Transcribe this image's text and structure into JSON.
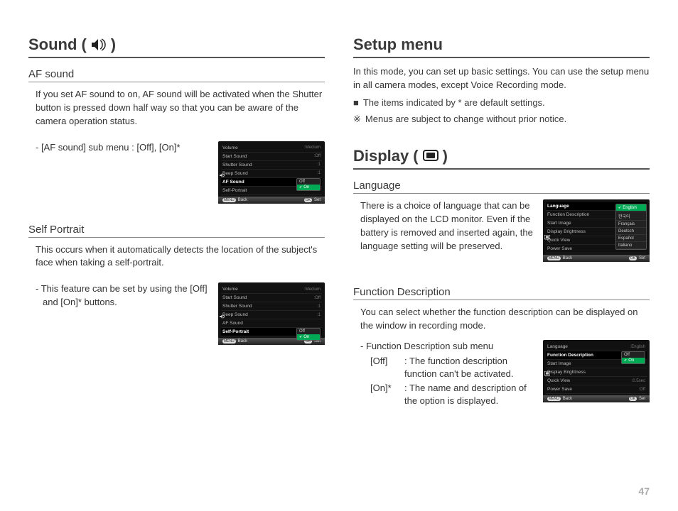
{
  "page_number": "47",
  "left": {
    "heading": "Sound",
    "heading_paren_open": "(",
    "heading_paren_close": ")",
    "af_sound": {
      "title": "AF sound",
      "body": "If you set AF sound to on, AF sound will be activated when the Shutter button is pressed down half way so that you can be aware of the camera operation status.",
      "sub": "- [AF sound] sub menu : [Off], [On]*"
    },
    "self_portrait": {
      "title": "Self Portrait",
      "body": "This occurs when it automatically detects the location of the subject's face when taking a self-portrait.",
      "sub1": "- This feature can be set by using the [Off]",
      "sub2": "and [On]* buttons."
    }
  },
  "right": {
    "setup_heading": "Setup menu",
    "setup_body": "In this mode, you can set up basic settings. You can use the setup menu in all camera modes, except Voice Recording mode.",
    "note1_sym": "■",
    "note1": "The items indicated by * are default settings.",
    "note2_sym": "※",
    "note2": "Menus are subject to change without prior notice.",
    "display_heading": "Display",
    "display_paren_open": "(",
    "display_paren_close": ")",
    "language": {
      "title": "Language",
      "body": "There is a choice of language that can be displayed on the LCD monitor. Even if the battery is removed and inserted again, the language setting will be preserved."
    },
    "func_desc": {
      "title": "Function Description",
      "body": "You can select whether the function description can be displayed on the window in recording mode.",
      "menu_label": "- Function Description sub menu",
      "off_key": "[Off]",
      "off_val": ": The function description function can't be activated.",
      "on_key": "[On]*",
      "on_val": ": The name and description of the option is displayed."
    }
  },
  "lcd_sound": {
    "rows": [
      {
        "label": "Volume",
        "value": ":Medium"
      },
      {
        "label": "Start Sound",
        "value": ":Off"
      },
      {
        "label": "Shutter Sound",
        "value": ":1"
      },
      {
        "label": "Beep Sound",
        "value": ":1"
      },
      {
        "label": "AF Sound",
        "value": ""
      },
      {
        "label": "Self-Portrait",
        "value": ""
      }
    ],
    "selected_index": 4,
    "popup": [
      "Off",
      "On"
    ],
    "popup_active": 1,
    "footer_back": "Back",
    "footer_set": "Set",
    "footer_back_btn": "MENU",
    "footer_set_btn": "OK"
  },
  "lcd_selfportrait": {
    "rows": [
      {
        "label": "Volume",
        "value": ":Medium"
      },
      {
        "label": "Start Sound",
        "value": ":Off"
      },
      {
        "label": "Shutter Sound",
        "value": ":1"
      },
      {
        "label": "Beep Sound",
        "value": ":1"
      },
      {
        "label": "AF Sound",
        "value": ""
      },
      {
        "label": "Self-Portrait",
        "value": ""
      }
    ],
    "selected_index": 5,
    "popup": [
      "Off",
      "On"
    ],
    "popup_active": 1,
    "footer_back": "Back",
    "footer_set": "Set",
    "footer_back_btn": "MENU",
    "footer_set_btn": "OK"
  },
  "lcd_language": {
    "rows": [
      {
        "label": "Language",
        "value": ""
      },
      {
        "label": "Function Description",
        "value": ""
      },
      {
        "label": "Start Image",
        "value": ""
      },
      {
        "label": "Display  Brightness",
        "value": ""
      },
      {
        "label": "Quick View",
        "value": ""
      },
      {
        "label": "Power Save",
        "value": ""
      }
    ],
    "selected_index": 0,
    "popup": [
      "English",
      "한국어",
      "Français",
      "Deutsch",
      "Español",
      "Italiano"
    ],
    "popup_active": 0,
    "footer_back": "Back",
    "footer_set": "Set",
    "footer_back_btn": "MENU",
    "footer_set_btn": "OK"
  },
  "lcd_funcdesc": {
    "rows": [
      {
        "label": "Language",
        "value": ":English"
      },
      {
        "label": "Function Description",
        "value": ""
      },
      {
        "label": "Start Image",
        "value": ""
      },
      {
        "label": "Display  Brightness",
        "value": ""
      },
      {
        "label": "Quick View",
        "value": ":0.5sec"
      },
      {
        "label": "Power Save",
        "value": ":Off"
      }
    ],
    "selected_index": 1,
    "popup": [
      "Off",
      "On"
    ],
    "popup_active": 1,
    "footer_back": "Back",
    "footer_set": "Set",
    "footer_back_btn": "MENU",
    "footer_set_btn": "OK"
  }
}
